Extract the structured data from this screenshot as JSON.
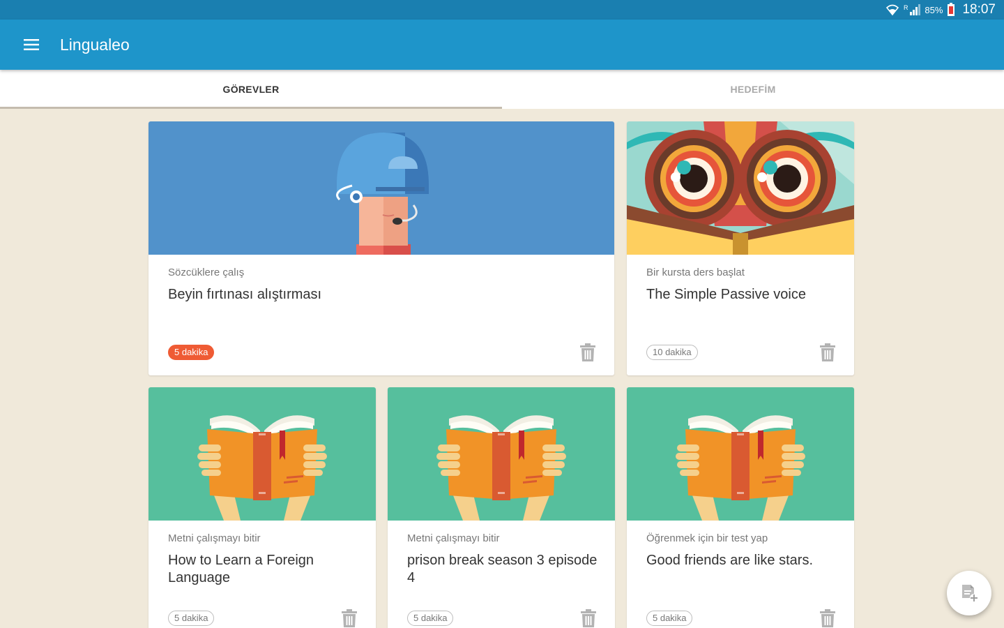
{
  "status_bar": {
    "battery_percent": "85%",
    "time": "18:07",
    "icons": [
      "wifi-icon",
      "signal-icon",
      "battery-icon"
    ]
  },
  "app_bar": {
    "title": "Lingualeo",
    "menu_icon": "hamburger-menu-icon"
  },
  "tabs": [
    {
      "label": "GÖREVLER",
      "active": true
    },
    {
      "label": "HEDEFİM",
      "active": false
    }
  ],
  "cards": [
    {
      "subtitle": "Sözcüklere çalış",
      "title": "Beyin fırtınası alıştırması",
      "duration": "5 dakika",
      "duration_highlight": true,
      "image": "helmet-head-illustration",
      "image_bg": "#5192cb"
    },
    {
      "subtitle": "Bir kursta ders başlat",
      "title": "The Simple Passive voice",
      "duration": "10 dakika",
      "duration_highlight": false,
      "image": "owl-illustration",
      "image_bg": "#9ad8cf"
    },
    {
      "subtitle": "Metni çalışmayı bitir",
      "title": "How to Learn a Foreign Language",
      "duration": "5 dakika",
      "duration_highlight": false,
      "image": "open-book-illustration",
      "image_bg": "#56bf9d"
    },
    {
      "subtitle": "Metni çalışmayı bitir",
      "title": "prison break season 3 episode 4",
      "duration": "5 dakika",
      "duration_highlight": false,
      "image": "open-book-illustration",
      "image_bg": "#56bf9d"
    },
    {
      "subtitle": "Öğrenmek için bir test yap",
      "title": "Good friends are like stars.",
      "duration": "5 dakika",
      "duration_highlight": false,
      "image": "open-book-illustration",
      "image_bg": "#56bf9d"
    }
  ],
  "fab": {
    "icon": "add-document-icon"
  },
  "colors": {
    "status_bar": "#1a7fb0",
    "app_bar": "#1e95ca",
    "background": "#f0e9da",
    "highlight_badge": "#ef5b34",
    "book_card_bg": "#56bf9d"
  }
}
